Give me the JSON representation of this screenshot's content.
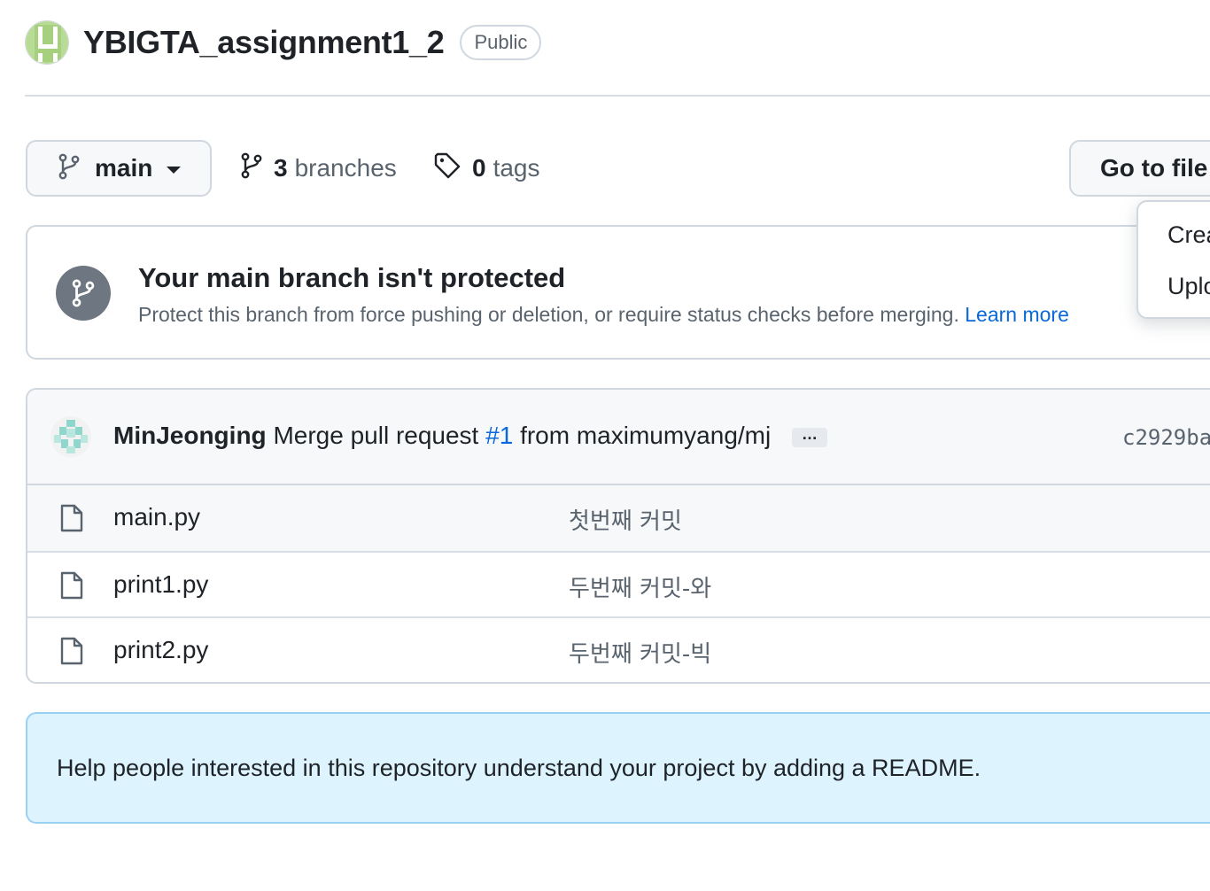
{
  "repo": {
    "name": "YBIGTA_assignment1_2",
    "visibility": "Public"
  },
  "toolbar": {
    "branch": "main",
    "branches_count": "3",
    "branches_label": "branches",
    "tags_count": "0",
    "tags_label": "tags",
    "goto_file": "Go to file"
  },
  "dropdown": {
    "items": [
      "Crea",
      "Uplo"
    ]
  },
  "protection": {
    "title": "Your main branch isn't protected",
    "description": "Protect this branch from force pushing or deletion, or require status checks before merging.",
    "link": "Learn more"
  },
  "commit": {
    "author": "MinJeonging",
    "message_prefix": "Merge pull request",
    "pr_link": "#1",
    "message_suffix": "from maximumyang/mj",
    "ellipsis": "…",
    "sha": "c2929ba"
  },
  "files": [
    {
      "name": "main.py",
      "message": "첫번째 커밋"
    },
    {
      "name": "print1.py",
      "message": "두번째 커밋-와"
    },
    {
      "name": "print2.py",
      "message": "두번째 커밋-빅"
    }
  ],
  "readme": {
    "text": "Help people interested in this repository understand your project by adding a README."
  },
  "colors": {
    "link": "#0969da",
    "border": "#d0d7de",
    "muted": "#59636e",
    "readme_bg": "#ddf4ff",
    "readme_border": "#9bd0f5",
    "avatar_green": "#a6cf7e"
  }
}
